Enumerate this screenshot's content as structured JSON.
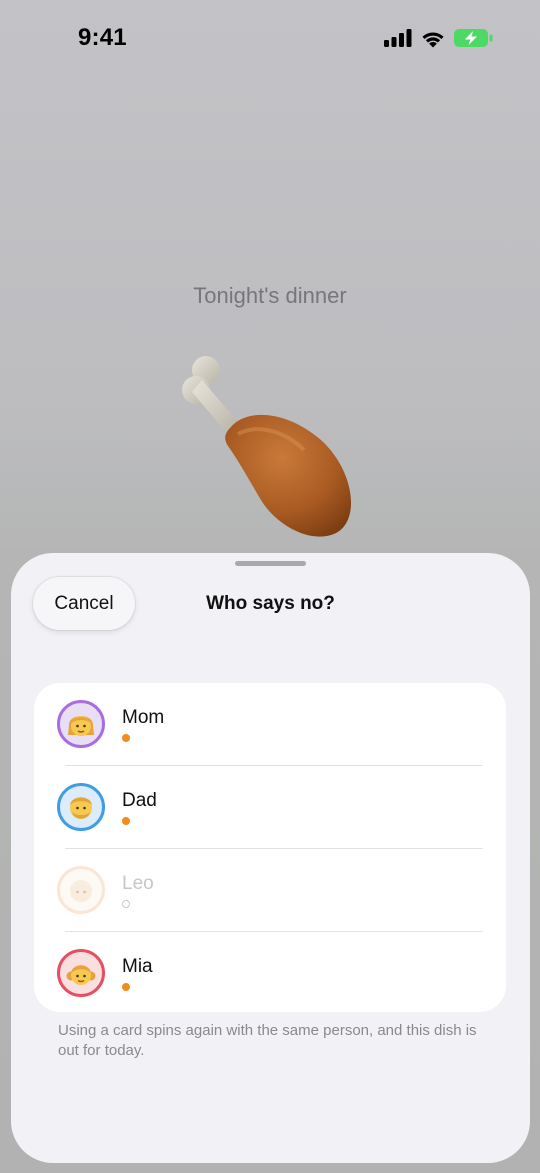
{
  "status_bar": {
    "time": "9:41",
    "battery_color": "#4cd964"
  },
  "background": {
    "title": "Tonight's dinner",
    "dish_icon": "poultry-leg"
  },
  "sheet": {
    "cancel_label": "Cancel",
    "title": "Who says no?",
    "people": [
      {
        "name": "Mom",
        "avatar_color": "#a86de0",
        "avatar_bg": "#e8dff6",
        "active": true
      },
      {
        "name": "Dad",
        "avatar_color": "#3e9de4",
        "avatar_bg": "#dcecfa",
        "active": true
      },
      {
        "name": "Leo",
        "avatar_color": "#f2b98d",
        "avatar_bg": "#fbeee3",
        "active": false
      },
      {
        "name": "Mia",
        "avatar_color": "#e6505e",
        "avatar_bg": "#fadfe1",
        "active": true
      }
    ],
    "footnote": "Using a card spins again with the same person, and this dish is out for today."
  },
  "colors": {
    "accent_dot": "#f28c1e"
  }
}
